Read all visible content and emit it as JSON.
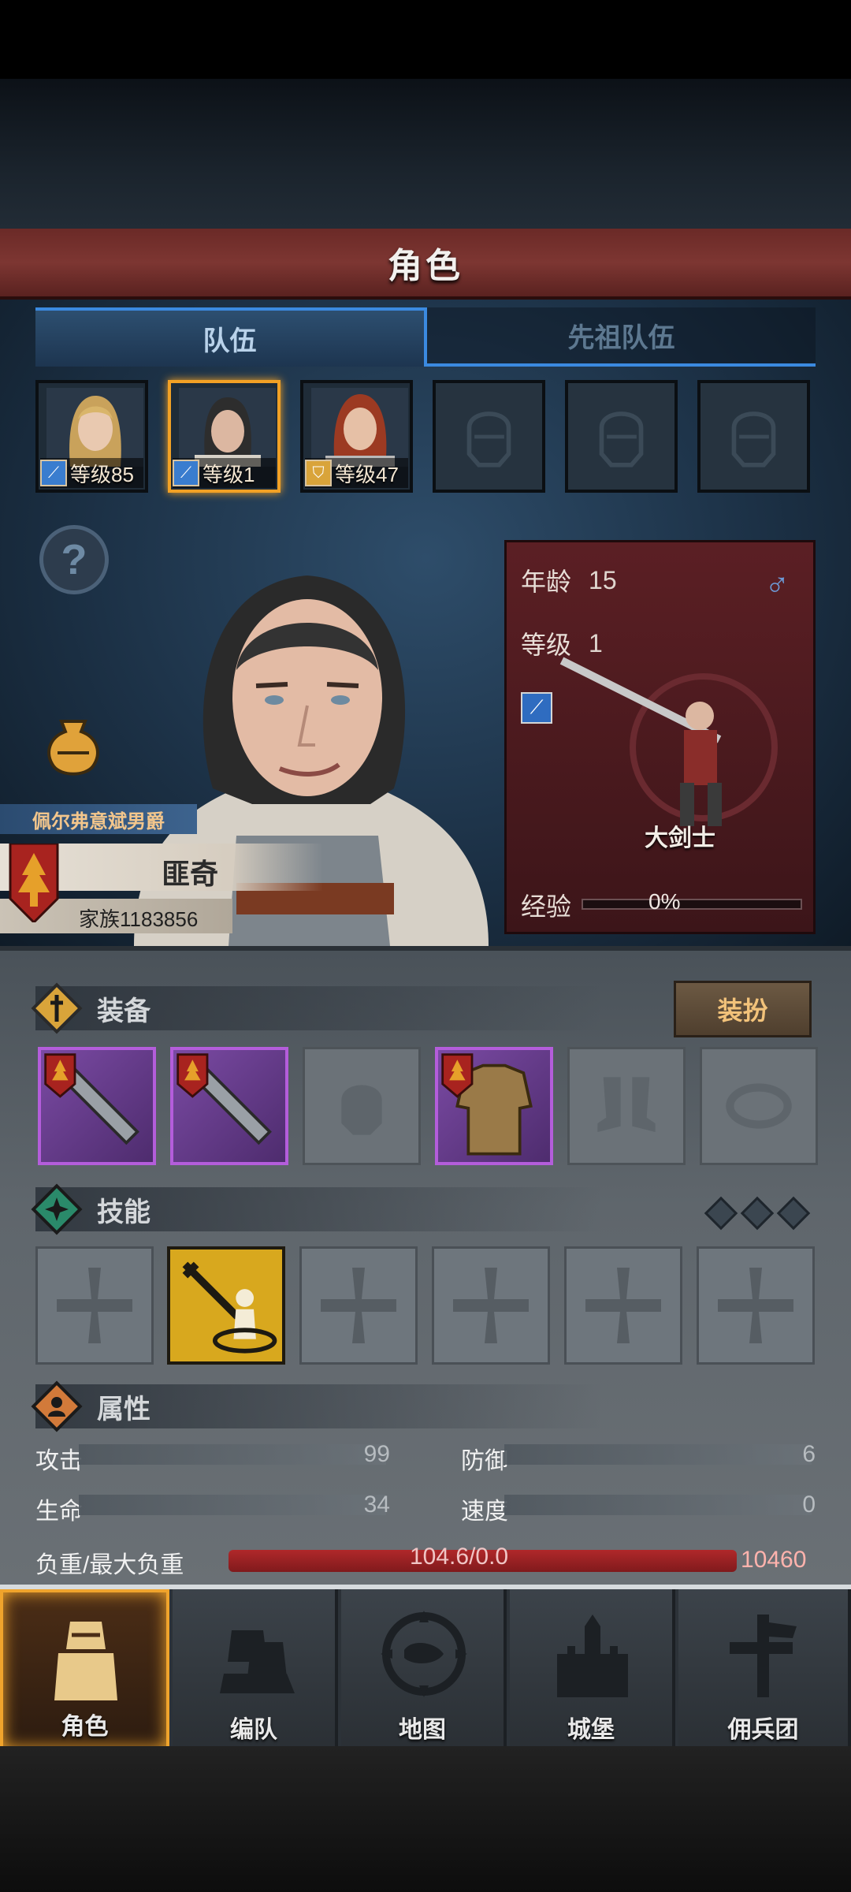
{
  "header": {
    "title": "角色"
  },
  "tabs": [
    {
      "label": "队伍",
      "active": true
    },
    {
      "label": "先祖队伍",
      "active": false
    }
  ],
  "team": [
    {
      "level_label": "等级85",
      "class_icon": "sword-icon",
      "badge_color": "#3a7dcf",
      "selected": false
    },
    {
      "level_label": "等级1",
      "class_icon": "sword-icon",
      "badge_color": "#3a7dcf",
      "selected": true
    },
    {
      "level_label": "等级47",
      "class_icon": "shield-icon",
      "badge_color": "#d9a43a",
      "selected": false
    },
    {
      "empty": true
    },
    {
      "empty": true
    },
    {
      "empty": true
    }
  ],
  "character": {
    "title": "佩尔弗意斌男爵",
    "name": "匪奇",
    "clan": "家族1183856",
    "age_label": "年龄",
    "age": "15",
    "level_label": "等级",
    "level": "1",
    "class_name": "大剑士",
    "exp_label": "经验",
    "exp": "0%",
    "gender_icon": "male-icon"
  },
  "equipment": {
    "title": "装备",
    "dress_button": "装扮",
    "slots": [
      "great-sword-icon",
      "great-sword-icon",
      "helmet-icon",
      "armor-icon",
      "boots-icon",
      "ring-icon"
    ]
  },
  "skills": {
    "title": "技能",
    "slots": [
      "cross-icon",
      "sword-skill-icon",
      "cross-icon",
      "cross-icon",
      "cross-icon",
      "cross-icon"
    ]
  },
  "attributes": {
    "title": "属性",
    "attack_label": "攻击",
    "attack": "99",
    "defense_label": "防御",
    "defense": "6",
    "hp_label": "生命",
    "hp": "34",
    "speed_label": "速度",
    "speed": "0",
    "load_label": "负重/最大负重",
    "load_value": "104.6/0.0",
    "load_max": "10460"
  },
  "nav": [
    {
      "label": "角色",
      "icon": "knight-icon",
      "active": true
    },
    {
      "label": "编队",
      "icon": "formation-icon",
      "active": false
    },
    {
      "label": "地图",
      "icon": "map-compass-icon",
      "active": false
    },
    {
      "label": "城堡",
      "icon": "castle-icon",
      "active": false
    },
    {
      "label": "佣兵团",
      "icon": "mercenary-icon",
      "active": false
    }
  ],
  "colors": {
    "accent_blue": "#3b8ae0",
    "header_red": "#7d3632",
    "selected_gold": "#f2a125",
    "item_purple": "#b45ddb",
    "skill_gold": "#d8a81e"
  }
}
